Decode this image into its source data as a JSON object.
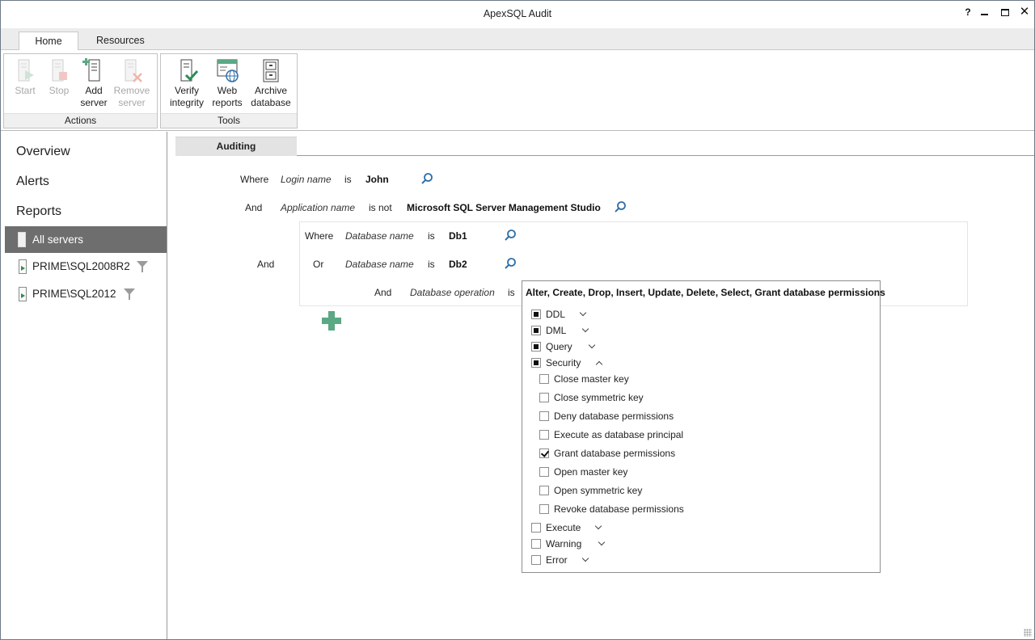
{
  "app": {
    "title": "ApexSQL Audit",
    "help_glyph": "?"
  },
  "ribbon": {
    "tabs": [
      {
        "label": "Home"
      },
      {
        "label": "Resources"
      }
    ],
    "groups": {
      "actions": {
        "label": "Actions",
        "buttons": [
          {
            "line1": "Start",
            "line2": "",
            "enabled": false
          },
          {
            "line1": "Stop",
            "line2": "",
            "enabled": false
          },
          {
            "line1": "Add",
            "line2": "server",
            "enabled": true
          },
          {
            "line1": "Remove",
            "line2": "server",
            "enabled": false
          }
        ]
      },
      "tools": {
        "label": "Tools",
        "buttons": [
          {
            "line1": "Verify",
            "line2": "integrity",
            "enabled": true
          },
          {
            "line1": "Web",
            "line2": "reports",
            "enabled": true
          },
          {
            "line1": "Archive",
            "line2": "database",
            "enabled": true
          }
        ]
      }
    }
  },
  "nav": {
    "links": [
      {
        "label": "Overview"
      },
      {
        "label": "Alerts"
      },
      {
        "label": "Reports"
      }
    ],
    "servers": [
      {
        "label": "All servers",
        "selected": true
      },
      {
        "label": "PRIME\\SQL2008R2",
        "selected": false
      },
      {
        "label": "PRIME\\SQL2012",
        "selected": false
      }
    ]
  },
  "main": {
    "tab": "Auditing",
    "filters": {
      "row1": {
        "conj": "Where",
        "field": "Login name",
        "op": "is",
        "value": "John"
      },
      "row2": {
        "conj": "And",
        "field": "Application name",
        "op": "is not",
        "value": "Microsoft SQL Server Management Studio"
      },
      "group_conj": "And",
      "group": {
        "row1": {
          "conj": "Where",
          "field": "Database name",
          "op": "is",
          "value": "Db1"
        },
        "row2": {
          "conj": "Or",
          "field": "Database name",
          "op": "is",
          "value": "Db2"
        },
        "row3": {
          "conj": "And",
          "field": "Database operation",
          "op": "is"
        }
      }
    },
    "dropdown": {
      "value": "Alter, Create, Drop, Insert, Update, Delete, Select, Grant database permissions",
      "categories": [
        {
          "label": "DDL",
          "state": "partial",
          "expanded": false
        },
        {
          "label": "DML",
          "state": "partial",
          "expanded": false
        },
        {
          "label": "Query",
          "state": "partial",
          "expanded": false
        },
        {
          "label": "Security",
          "state": "partial",
          "expanded": true
        }
      ],
      "security_items": [
        {
          "label": "Close master key",
          "checked": false
        },
        {
          "label": "Close symmetric key",
          "checked": false
        },
        {
          "label": "Deny database permissions",
          "checked": false
        },
        {
          "label": "Execute as database principal",
          "checked": false
        },
        {
          "label": "Grant database permissions",
          "checked": true
        },
        {
          "label": "Open master key",
          "checked": false
        },
        {
          "label": "Open symmetric key",
          "checked": false
        },
        {
          "label": "Revoke database permissions",
          "checked": false
        }
      ],
      "more_categories": [
        {
          "label": "Execute",
          "state": "unchecked",
          "expanded": false
        },
        {
          "label": "Warning",
          "state": "unchecked",
          "expanded": false
        },
        {
          "label": "Error",
          "state": "unchecked",
          "expanded": false
        }
      ]
    }
  },
  "colors": {
    "selected_server_bg": "#6e6e6e",
    "add_icon": "#5aa884",
    "accent_icon": "#2e8b57"
  }
}
